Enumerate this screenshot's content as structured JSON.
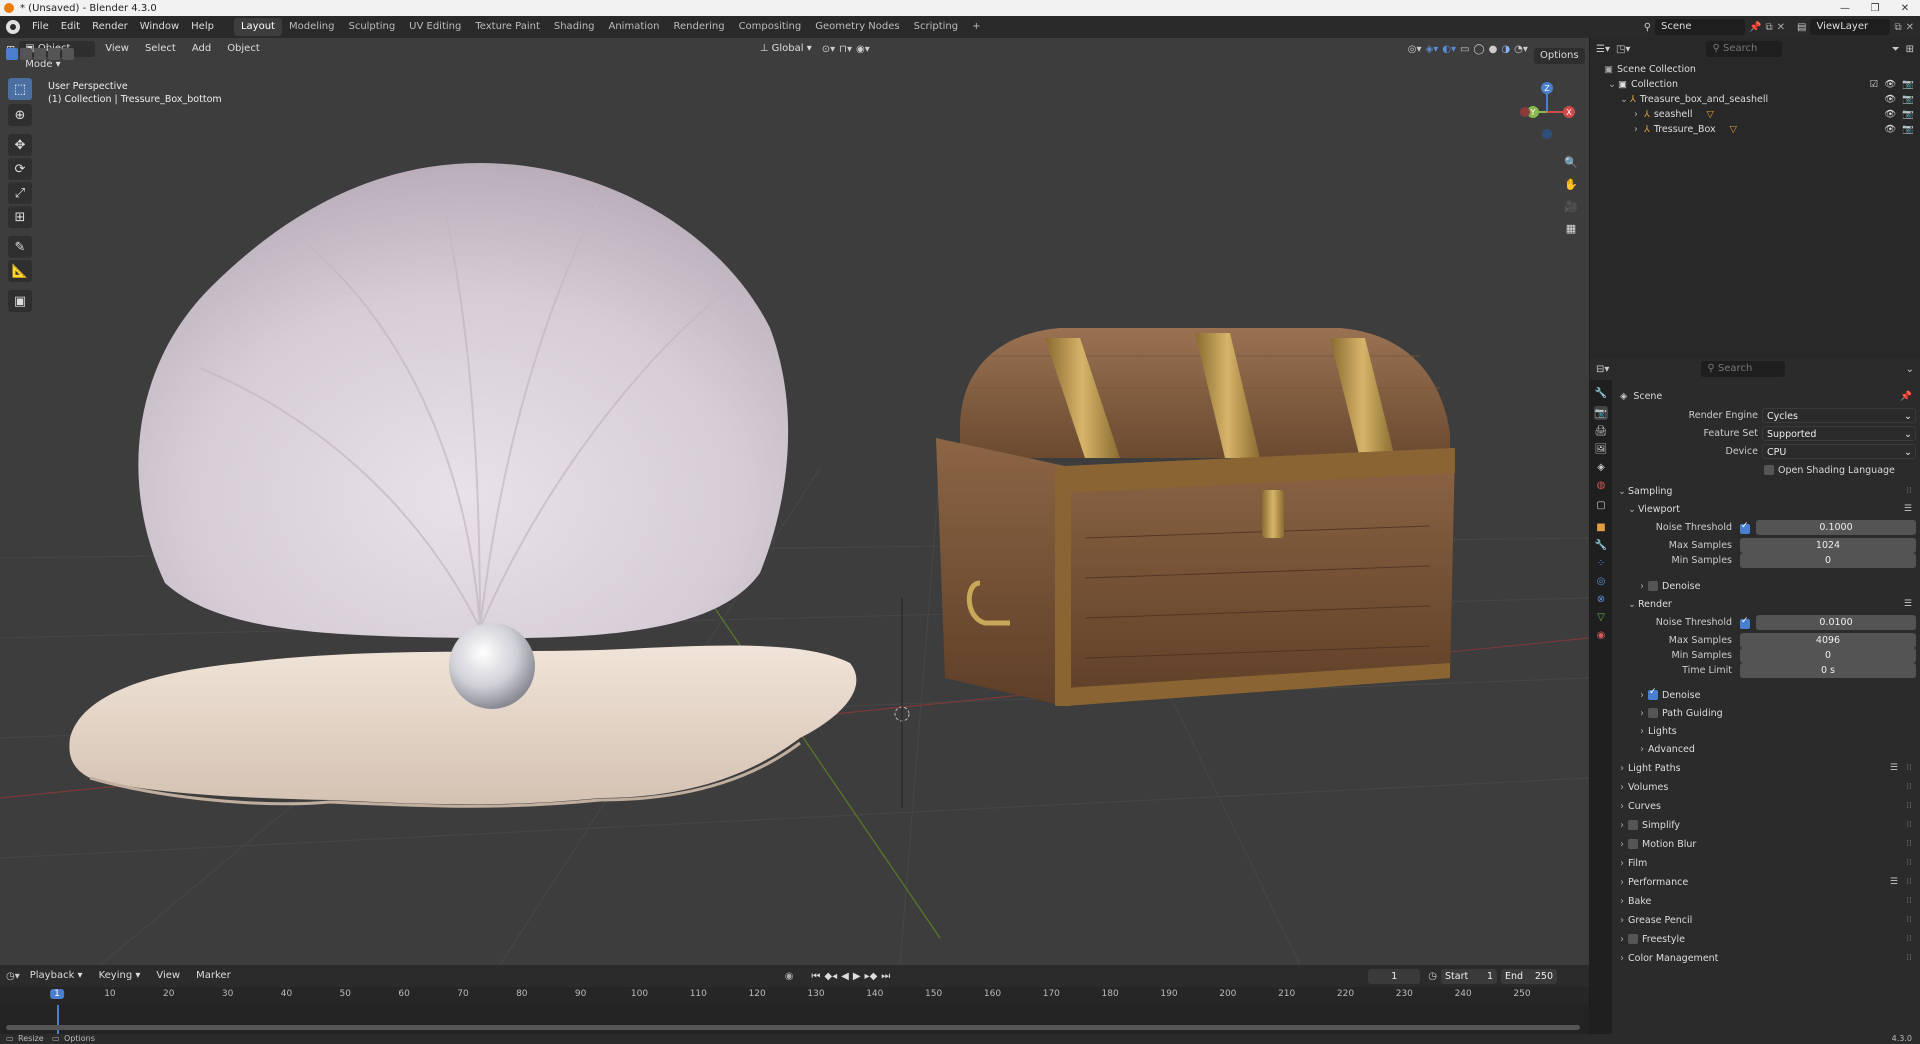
{
  "window": {
    "title": "* (Unsaved) - Blender 4.3.0",
    "controls": [
      "—",
      "❐",
      "✕"
    ]
  },
  "menu": [
    "File",
    "Edit",
    "Render",
    "Window",
    "Help"
  ],
  "workspaces": [
    "Layout",
    "Modeling",
    "Sculpting",
    "UV Editing",
    "Texture Paint",
    "Shading",
    "Animation",
    "Rendering",
    "Compositing",
    "Geometry Nodes",
    "Scripting",
    "+"
  ],
  "active_workspace": "Layout",
  "scene_selector": "Scene",
  "view_layer": "ViewLayer",
  "viewport": {
    "mode": "Object Mode",
    "menus": [
      "View",
      "Select",
      "Add",
      "Object"
    ],
    "transform_orientation": "Global",
    "options_label": "Options",
    "overlay_title": "User Perspective",
    "overlay_subtitle": "(1) Collection | Tressure_Box_bottom",
    "search_placeholder": "Search",
    "gizmo_axes": [
      "X",
      "Y",
      "Z"
    ]
  },
  "tools": [
    "select-box-icon",
    "cursor-icon",
    "move-icon",
    "rotate-icon",
    "scale-icon",
    "transform-icon",
    "annotate-icon",
    "measure-icon",
    "add-cube-icon"
  ],
  "outliner": {
    "search_placeholder": "Search",
    "rows": [
      {
        "label": "Scene Collection",
        "level": 0
      },
      {
        "label": "Collection",
        "level": 1
      },
      {
        "label": "Treasure_box_and_seashell",
        "level": 2
      },
      {
        "label": "seashell",
        "level": 3
      },
      {
        "label": "Tressure_Box",
        "level": 3
      }
    ]
  },
  "properties": {
    "search_placeholder": "Search",
    "header": "Scene",
    "render_engine_label": "Render Engine",
    "render_engine": "Cycles",
    "feature_set_label": "Feature Set",
    "feature_set": "Supported",
    "device_label": "Device",
    "device": "CPU",
    "osl_label": "Open Shading Language",
    "sampling": "Sampling",
    "viewport_sub": "Viewport",
    "vp_noise_label": "Noise Threshold",
    "vp_noise": "0.1000",
    "vp_max_label": "Max Samples",
    "vp_max": "1024",
    "vp_min_label": "Min Samples",
    "vp_min": "0",
    "vp_denoise": "Denoise",
    "render_sub": "Render",
    "r_noise_label": "Noise Threshold",
    "r_noise": "0.0100",
    "r_max_label": "Max Samples",
    "r_max": "4096",
    "r_min_label": "Min Samples",
    "r_min": "0",
    "r_time_label": "Time Limit",
    "r_time": "0 s",
    "r_denoise": "Denoise",
    "path_guiding": "Path Guiding",
    "lights": "Lights",
    "advanced": "Advanced",
    "panels": [
      "Light Paths",
      "Volumes",
      "Curves",
      "Simplify",
      "Motion Blur",
      "Film",
      "Performance",
      "Bake",
      "Grease Pencil",
      "Freestyle",
      "Color Management"
    ]
  },
  "timeline": {
    "menus": [
      "Playback",
      "Keying",
      "View",
      "Marker"
    ],
    "current_frame": "1",
    "start_label": "Start",
    "start": "1",
    "end_label": "End",
    "end": "250",
    "ticks": [
      "1",
      "10",
      "20",
      "30",
      "40",
      "50",
      "60",
      "70",
      "80",
      "90",
      "100",
      "110",
      "120",
      "130",
      "140",
      "150",
      "160",
      "170",
      "180",
      "190",
      "200",
      "210",
      "220",
      "230",
      "240",
      "250"
    ]
  },
  "status": {
    "left1": "Resize",
    "left2": "Options",
    "version": "4.3.0"
  }
}
